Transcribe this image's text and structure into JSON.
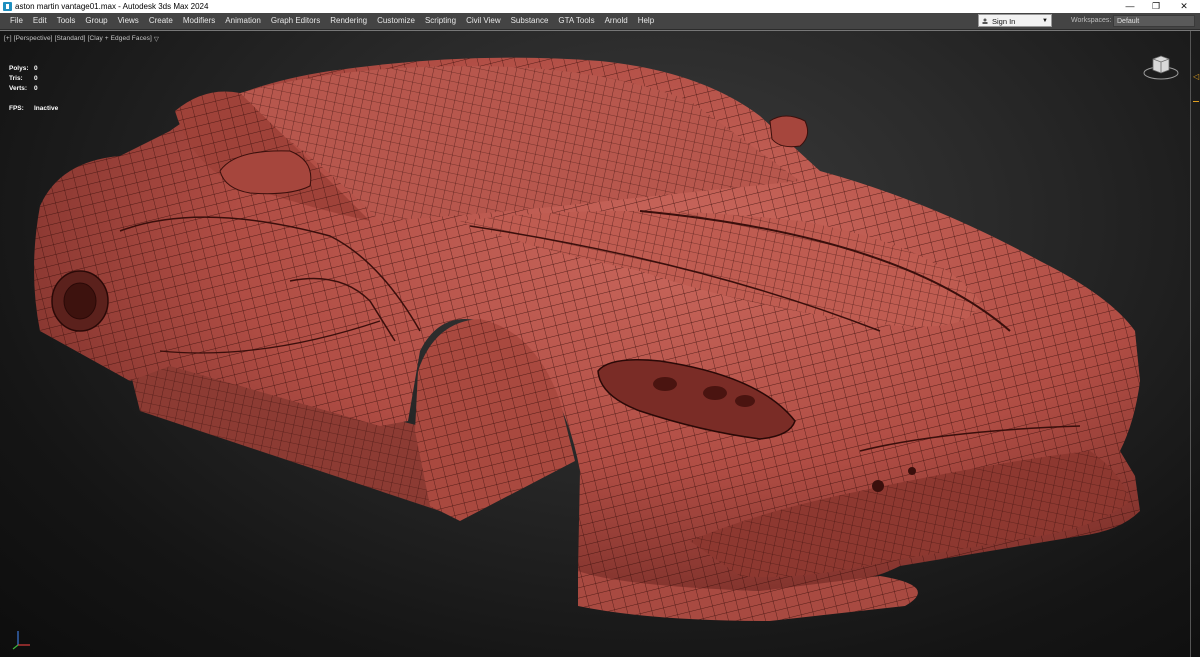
{
  "window": {
    "title": "aston martin vantage01.max - Autodesk 3ds Max 2024",
    "minimize_glyph": "—",
    "restore_glyph": "❐",
    "close_glyph": "✕"
  },
  "menu": {
    "items": [
      "File",
      "Edit",
      "Tools",
      "Group",
      "Views",
      "Create",
      "Modifiers",
      "Animation",
      "Graph Editors",
      "Rendering",
      "Customize",
      "Scripting",
      "Civil View",
      "Substance",
      "GTA Tools",
      "Arnold",
      "Help"
    ]
  },
  "account": {
    "sign_in_label": "Sign In",
    "workspaces_label": "Workspaces:",
    "workspace_value": "Default"
  },
  "viewport": {
    "labels": [
      "[+]",
      "[Perspective]",
      "[Standard]",
      "[Clay + Edged Faces]",
      "▽"
    ],
    "stats": {
      "polys_label": "Polys:",
      "polys_value": "0",
      "tris_label": "Tris:",
      "tris_value": "0",
      "verts_label": "Verts:",
      "verts_value": "0",
      "fps_label": "FPS:",
      "fps_value": "Inactive"
    },
    "colors": {
      "clay": "#b8534a",
      "clay_dark": "#7a2f29",
      "wire": "#3a0f0c"
    },
    "icons": [
      "viewcube-icon",
      "axis-tripod-icon"
    ]
  }
}
